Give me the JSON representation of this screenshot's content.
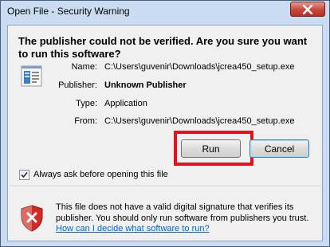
{
  "window": {
    "title": "Open File - Security Warning"
  },
  "headline": "The publisher could not be verified.  Are you sure you want to run this software?",
  "details": [
    {
      "label": "Name:",
      "value": "C:\\Users\\guvenir\\Downloads\\jcrea450_setup.exe",
      "bold": false
    },
    {
      "label": "Publisher:",
      "value": "Unknown Publisher",
      "bold": true
    },
    {
      "label": "Type:",
      "value": "Application",
      "bold": false
    },
    {
      "label": "From:",
      "value": "C:\\Users\\guvenir\\Downloads\\jcrea450_setup.exe",
      "bold": false
    }
  ],
  "buttons": {
    "run": "Run",
    "cancel": "Cancel"
  },
  "checkbox": {
    "label": "Always ask before opening this file",
    "checked": true
  },
  "warning": {
    "text": "This file does not have a valid digital signature that verifies its publisher.  You should only run software from publishers you trust.",
    "link": "How can I decide what software to run?"
  },
  "icons": {
    "app": "application-icon",
    "shield": "security-shield-icon",
    "close": "close-icon",
    "check": "checkmark-icon"
  },
  "colors": {
    "highlight": "#e0121e",
    "link": "#0066cc",
    "close": "#c6473a"
  }
}
